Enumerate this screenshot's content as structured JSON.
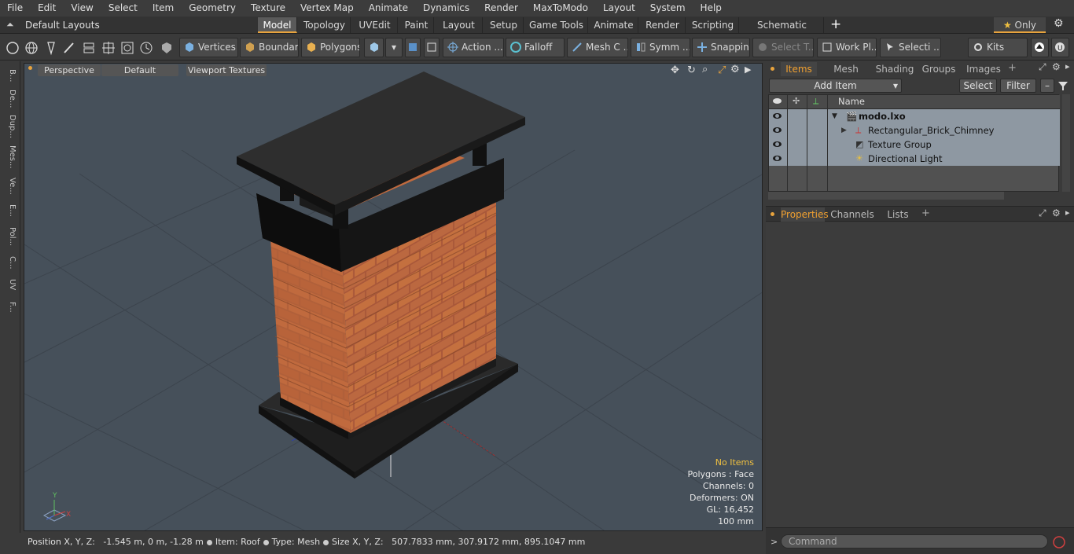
{
  "menu": [
    "File",
    "Edit",
    "View",
    "Select",
    "Item",
    "Geometry",
    "Texture",
    "Vertex Map",
    "Animate",
    "Dynamics",
    "Render",
    "MaxToModo",
    "Layout",
    "System",
    "Help"
  ],
  "layout_selector": "Default Layouts",
  "layout_tabs": [
    "Model",
    "Topology",
    "UVEdit",
    "Paint",
    "Layout",
    "Setup",
    "Game Tools",
    "Animate",
    "Render",
    "Scripting",
    "Schematic Fusion"
  ],
  "active_layout_tab": "Model",
  "only_label": "Only",
  "toolbar": {
    "vertices": "Vertices",
    "boundary": "Boundary",
    "polygons": "Polygons",
    "action": "Action ...",
    "falloff": "Falloff",
    "meshc": "Mesh C ...",
    "symm": "Symm ...",
    "snapping": "Snapping",
    "selectt": "Select T...",
    "workpl": "Work Pl...",
    "selecti": "Selecti ...",
    "kits": "Kits"
  },
  "left_tabs": [
    "B...",
    "De...",
    "Dup...",
    "Mes...",
    "Ve...",
    "E...",
    "Pol...",
    "C...",
    "UV",
    "F..."
  ],
  "viewport": {
    "perspective": "Perspective",
    "default": "Default",
    "textures": "Viewport Textures",
    "stats": {
      "no_items": "No Items",
      "polygons": "Polygons : Face",
      "channels": "Channels: 0",
      "deformers": "Deformers: ON",
      "gl": "GL: 16,452",
      "scale": "100 mm"
    }
  },
  "statusbar": {
    "position_label": "Position X, Y, Z:",
    "position_value": "-1.545 m, 0 m, -1.28 m",
    "item_label": "Item:",
    "item_value": "Roof",
    "type_label": "Type:",
    "type_value": "Mesh",
    "size_label": "Size X, Y, Z:",
    "size_value": "507.7833 mm, 307.9172 mm, 895.1047 mm"
  },
  "items_panel": {
    "tabs": [
      "Items",
      "Mesh Ops",
      "Shading",
      "Groups",
      "Images"
    ],
    "active_tab": "Items",
    "add_item": "Add Item",
    "select": "Select",
    "filter": "Filter",
    "name_header": "Name",
    "rows": [
      {
        "label": "modo.lxo"
      },
      {
        "label": "Rectangular_Brick_Chimney"
      },
      {
        "label": "Texture Group"
      },
      {
        "label": "Directional Light"
      }
    ]
  },
  "properties_panel": {
    "tabs": [
      "Properties",
      "Channels",
      "Lists"
    ],
    "active_tab": "Properties"
  },
  "command": {
    "placeholder": "Command"
  },
  "colors": {
    "accent": "#e8a33d",
    "viewport_bg": "#46505a",
    "selection_row": "#8e98a2"
  }
}
